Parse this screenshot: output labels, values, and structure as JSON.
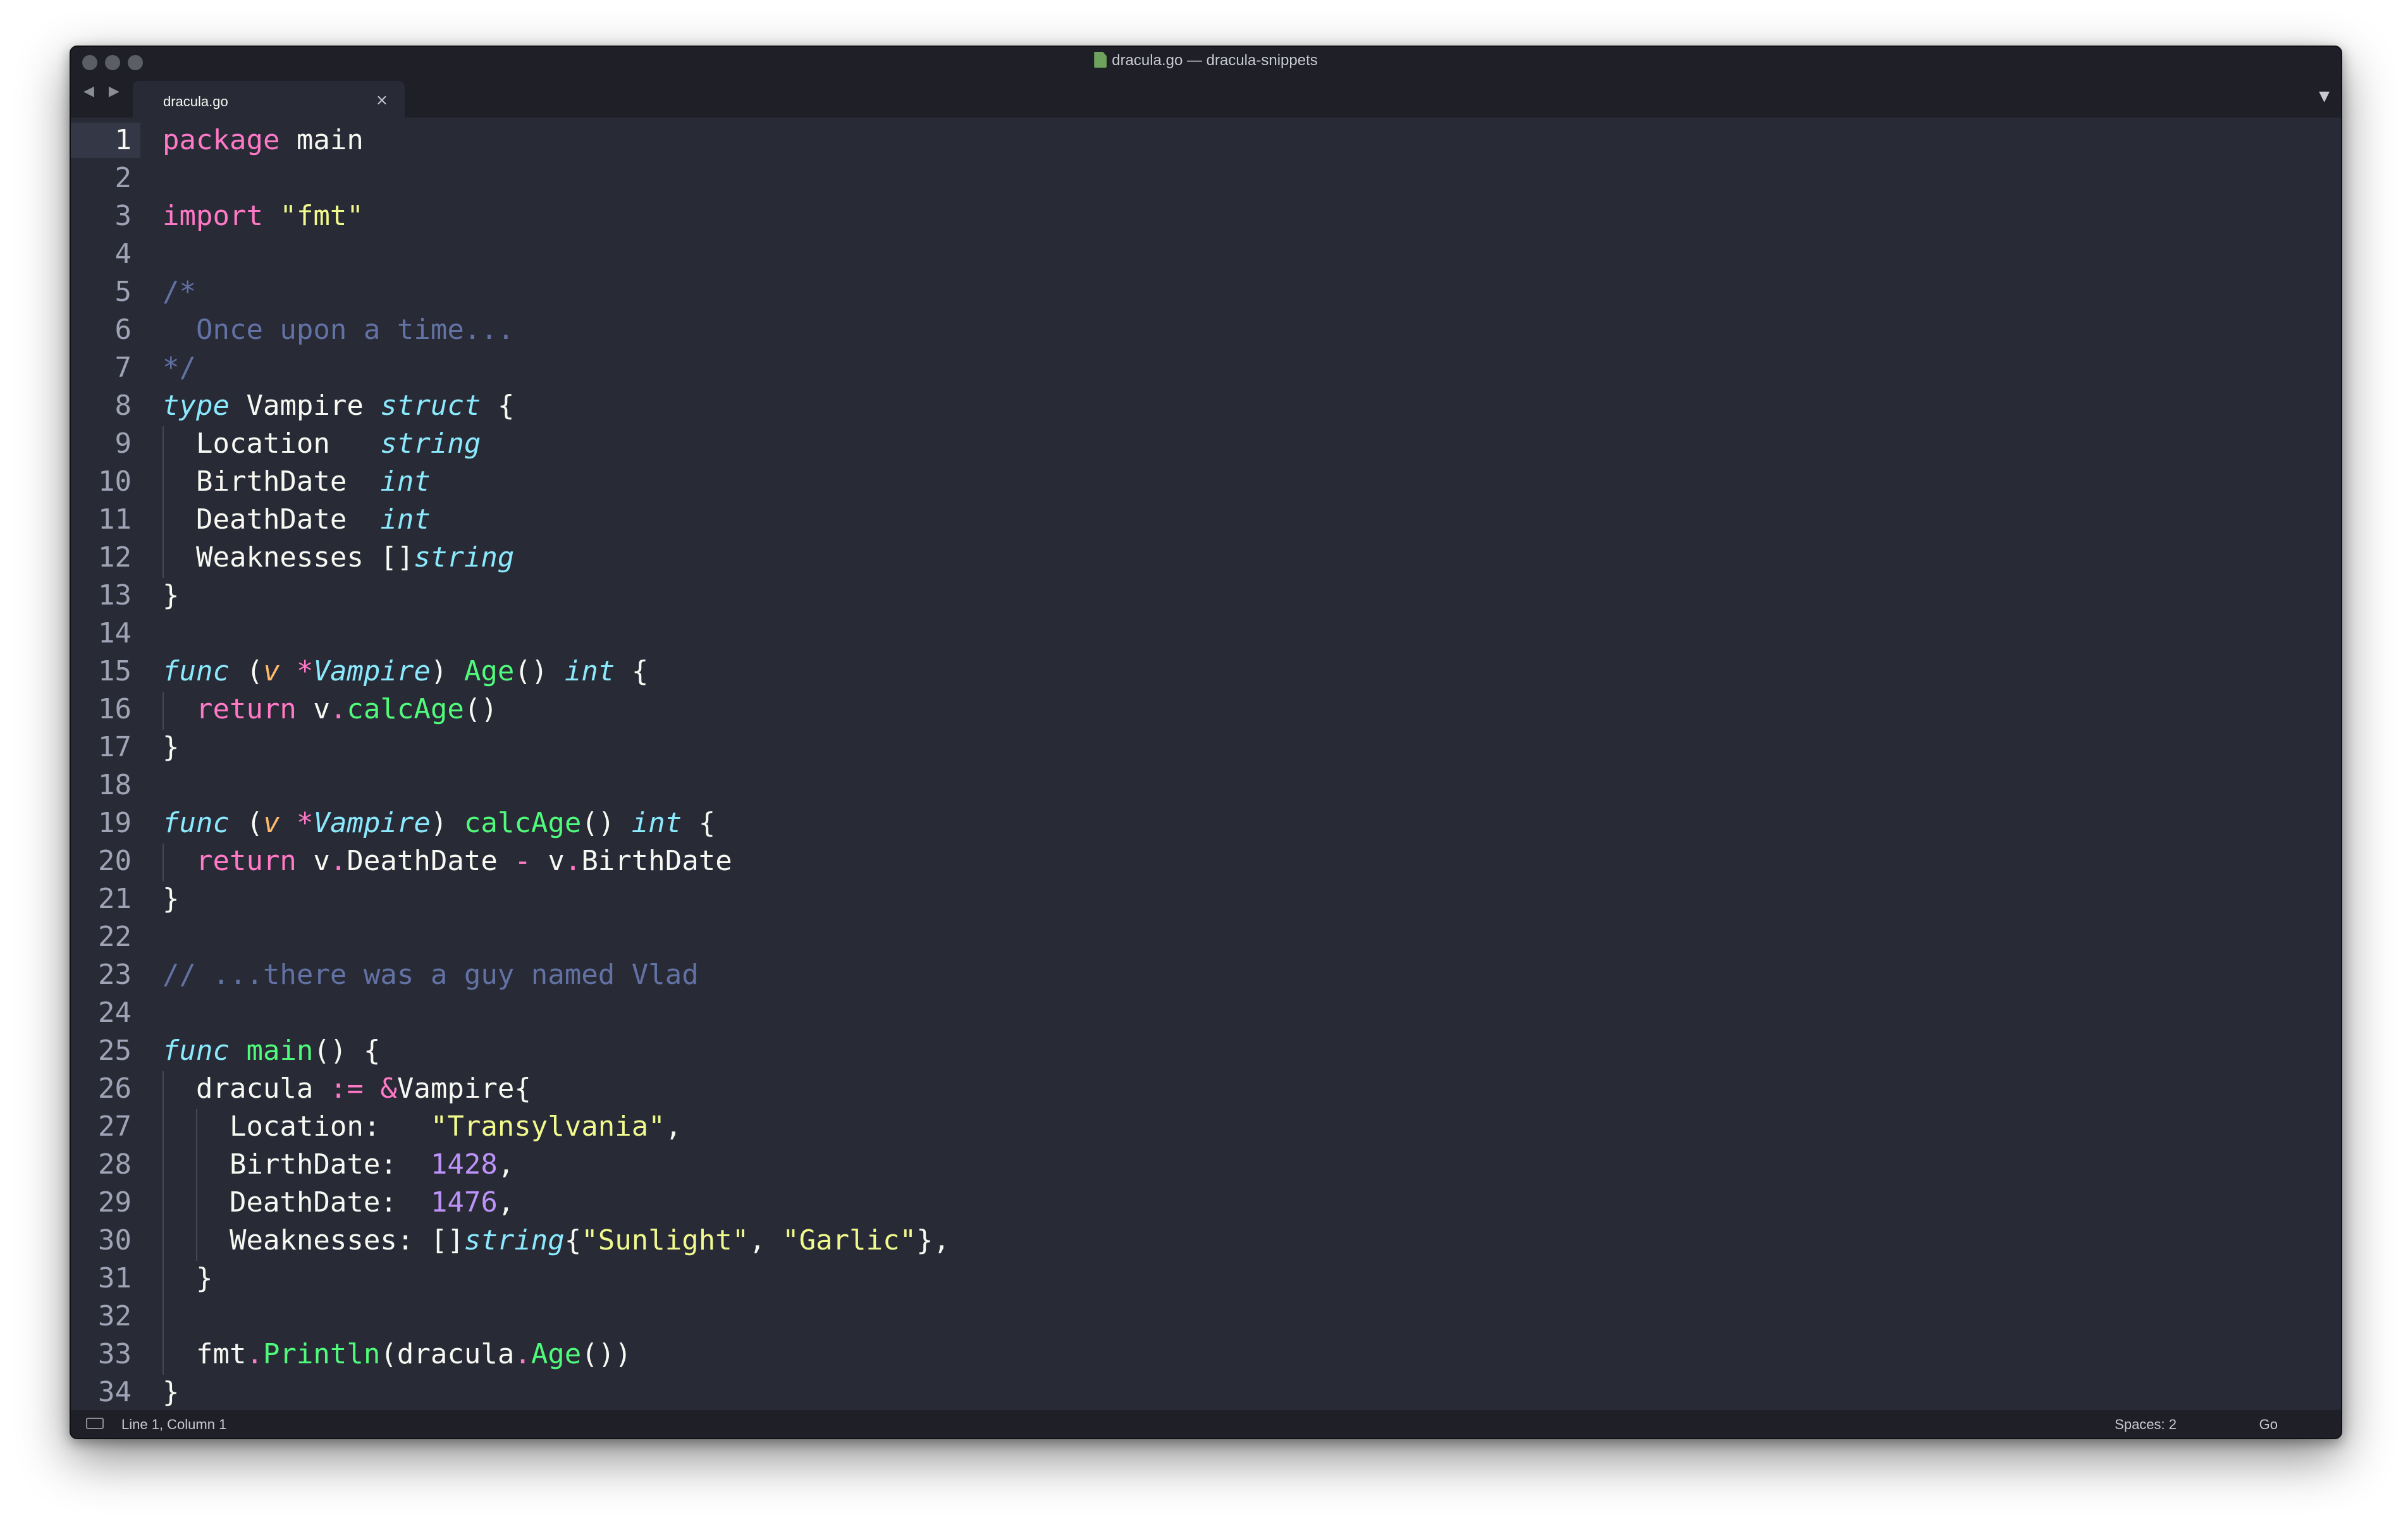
{
  "window": {
    "title": "dracula.go — dracula-snippets"
  },
  "tab": {
    "label": "dracula.go",
    "close": "×"
  },
  "nav": {
    "arrows": "◀ ▶"
  },
  "dropdown": "▼",
  "colors": {
    "background": "#282a36",
    "foreground": "#f8f8f2",
    "comment": "#6272a4",
    "keyword": "#ff79c6",
    "string": "#f1fa8c",
    "function": "#50fa7b",
    "type": "#8be9fd",
    "number": "#bd93f9",
    "param": "#ffb86c"
  },
  "code": {
    "lines": [
      [
        [
          "kw",
          "package"
        ],
        [
          "pl",
          " main"
        ]
      ],
      [],
      [
        [
          "kw",
          "import"
        ],
        [
          "pl",
          " "
        ],
        [
          "str",
          "\"fmt\""
        ]
      ],
      [],
      [
        [
          "cm",
          "/*"
        ]
      ],
      [
        [
          "cm",
          "  Once upon a time..."
        ]
      ],
      [
        [
          "cm",
          "*/"
        ]
      ],
      [
        [
          "ty",
          "type"
        ],
        [
          "pl",
          " Vampire "
        ],
        [
          "ty",
          "struct"
        ],
        [
          "pl",
          " {"
        ]
      ],
      [
        [
          "pl",
          "  Location   "
        ],
        [
          "ty",
          "string"
        ]
      ],
      [
        [
          "pl",
          "  BirthDate  "
        ],
        [
          "ty",
          "int"
        ]
      ],
      [
        [
          "pl",
          "  DeathDate  "
        ],
        [
          "ty",
          "int"
        ]
      ],
      [
        [
          "pl",
          "  Weaknesses []"
        ],
        [
          "ty",
          "string"
        ]
      ],
      [
        [
          "pl",
          "}"
        ]
      ],
      [],
      [
        [
          "ty",
          "func"
        ],
        [
          "pl",
          " ("
        ],
        [
          "pa",
          "v"
        ],
        [
          "pl",
          " "
        ],
        [
          "kw",
          "*"
        ],
        [
          "ty",
          "Vampire"
        ],
        [
          "pl",
          ") "
        ],
        [
          "fn",
          "Age"
        ],
        [
          "pl",
          "() "
        ],
        [
          "ty",
          "int"
        ],
        [
          "pl",
          " {"
        ]
      ],
      [
        [
          "pl",
          "  "
        ],
        [
          "kw",
          "return"
        ],
        [
          "pl",
          " v"
        ],
        [
          "kw",
          "."
        ],
        [
          "fn",
          "calcAge"
        ],
        [
          "pl",
          "()"
        ]
      ],
      [
        [
          "pl",
          "}"
        ]
      ],
      [],
      [
        [
          "ty",
          "func"
        ],
        [
          "pl",
          " ("
        ],
        [
          "pa",
          "v"
        ],
        [
          "pl",
          " "
        ],
        [
          "kw",
          "*"
        ],
        [
          "ty",
          "Vampire"
        ],
        [
          "pl",
          ") "
        ],
        [
          "fn",
          "calcAge"
        ],
        [
          "pl",
          "() "
        ],
        [
          "ty",
          "int"
        ],
        [
          "pl",
          " {"
        ]
      ],
      [
        [
          "pl",
          "  "
        ],
        [
          "kw",
          "return"
        ],
        [
          "pl",
          " v"
        ],
        [
          "kw",
          "."
        ],
        [
          "pl",
          "DeathDate "
        ],
        [
          "kw",
          "-"
        ],
        [
          "pl",
          " v"
        ],
        [
          "kw",
          "."
        ],
        [
          "pl",
          "BirthDate"
        ]
      ],
      [
        [
          "pl",
          "}"
        ]
      ],
      [],
      [
        [
          "cm",
          "// ...there was a guy named Vlad"
        ]
      ],
      [],
      [
        [
          "ty",
          "func"
        ],
        [
          "pl",
          " "
        ],
        [
          "fn",
          "main"
        ],
        [
          "pl",
          "() {"
        ]
      ],
      [
        [
          "pl",
          "  dracula "
        ],
        [
          "kw",
          ":="
        ],
        [
          "pl",
          " "
        ],
        [
          "kw",
          "&"
        ],
        [
          "pl",
          "Vampire{"
        ]
      ],
      [
        [
          "pl",
          "    Location:   "
        ],
        [
          "str",
          "\"Transylvania\""
        ],
        [
          "pl",
          ","
        ]
      ],
      [
        [
          "pl",
          "    BirthDate:  "
        ],
        [
          "num",
          "1428"
        ],
        [
          "pl",
          ","
        ]
      ],
      [
        [
          "pl",
          "    DeathDate:  "
        ],
        [
          "num",
          "1476"
        ],
        [
          "pl",
          ","
        ]
      ],
      [
        [
          "pl",
          "    Weaknesses: []"
        ],
        [
          "ty",
          "string"
        ],
        [
          "pl",
          "{"
        ],
        [
          "str",
          "\"Sunlight\""
        ],
        [
          "pl",
          ", "
        ],
        [
          "str",
          "\"Garlic\""
        ],
        [
          "pl",
          "},"
        ]
      ],
      [
        [
          "pl",
          "  }"
        ]
      ],
      [],
      [
        [
          "pl",
          "  fmt"
        ],
        [
          "kw",
          "."
        ],
        [
          "fn",
          "Println"
        ],
        [
          "pl",
          "(dracula"
        ],
        [
          "kw",
          "."
        ],
        [
          "fn",
          "Age"
        ],
        [
          "pl",
          "())"
        ]
      ],
      [
        [
          "pl",
          "}"
        ]
      ]
    ]
  },
  "status": {
    "position": "Line 1, Column 1",
    "spaces": "Spaces: 2",
    "language": "Go"
  }
}
